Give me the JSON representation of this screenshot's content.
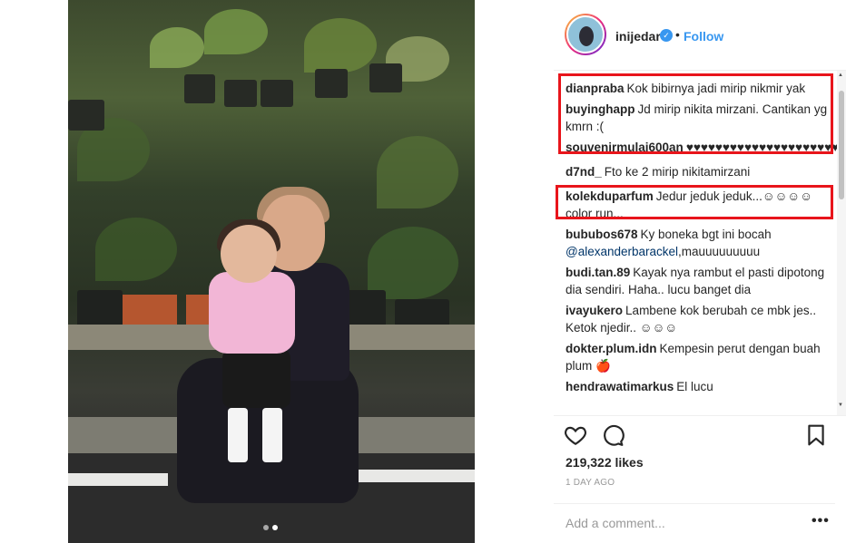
{
  "post": {
    "username": "inijedar",
    "separator": "•",
    "follow_label": "Follow",
    "verified_icon": "verified-badge-icon",
    "likes": "219,322 likes",
    "time": "1 DAY AGO",
    "comment_placeholder": "Add a comment...",
    "more_label": "•••",
    "carousel": {
      "count": 2,
      "active": 2
    }
  },
  "comments": [
    {
      "user": "dianpraba",
      "text": "Kok bibirnya jadi mirip nikmir yak"
    },
    {
      "user": "buyinghapp",
      "text": "Jd mirip nikita mirzani. Cantikan yg kmrn :("
    },
    {
      "user": "souvenirmulai600an",
      "text": "♥♥♥♥♥♥♥♥♥♥♥♥♥♥♥♥♥♥♥♥♥♥♥♥"
    },
    {
      "user": "d7nd_",
      "text": "Fto ke 2 mirip nikitamirzani"
    },
    {
      "user": "kolekduparfum",
      "text": "Jedur jeduk jeduk...☺☺☺☺ color run..."
    },
    {
      "user": "bububos678",
      "text": "Ky boneka bgt ini bocah",
      "mention": "@alexanderbarackel",
      "after": ",mauuuuuuuuu"
    },
    {
      "user": "budi.tan.89",
      "text": "Kayak nya rambut el pasti dipotong dia sendiri. Haha.. lucu banget dia"
    },
    {
      "user": "ivayukero",
      "text": "Lambene kok berubah ce mbk jes.. Ketok njedir.. ☺☺☺"
    },
    {
      "user": "dokter.plum.idn",
      "text": "Kempesin perut dengan buah plum 🍎"
    },
    {
      "user": "hendrawatimarkus",
      "text": "El lucu"
    }
  ],
  "colors": {
    "accent": "#3897f0",
    "highlight": "#e8151b",
    "mention": "#003569",
    "muted": "#999999"
  },
  "icons": {
    "like": "heart-icon",
    "comment": "comment-bubble-icon",
    "save": "bookmark-icon"
  }
}
